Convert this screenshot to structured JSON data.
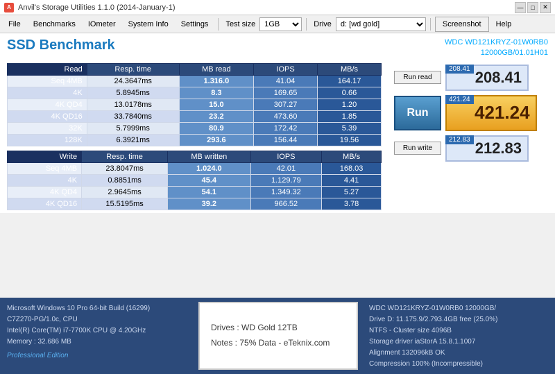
{
  "titleBar": {
    "title": "Anvil's Storage Utilities 1.1.0 (2014-January-1)",
    "icon": "A",
    "controls": [
      "—",
      "□",
      "✕"
    ]
  },
  "menuBar": {
    "items": [
      "File",
      "Benchmarks",
      "IOmeter",
      "System Info",
      "Settings"
    ],
    "testSizeLabel": "Test size",
    "testSizeValue": "1GB",
    "driveLabel": "Drive",
    "driveValue": "d: [wd gold]",
    "screenshotLabel": "Screenshot",
    "helpLabel": "Help"
  },
  "header": {
    "title": "SSD Benchmark",
    "driveModel": "WDC WD121KRYZ-01W0RB0",
    "driveSize": "12000GB/01.01H01"
  },
  "readTable": {
    "headers": [
      "Read",
      "Resp. time",
      "MB read",
      "IOPS",
      "MB/s"
    ],
    "rows": [
      {
        "label": "Seq 4MB",
        "resp": "24.3647ms",
        "mb": "1.316.0",
        "iops": "41.04",
        "mbs": "164.17"
      },
      {
        "label": "4K",
        "resp": "5.8945ms",
        "mb": "8.3",
        "iops": "169.65",
        "mbs": "0.66"
      },
      {
        "label": "4K QD4",
        "resp": "13.0178ms",
        "mb": "15.0",
        "iops": "307.27",
        "mbs": "1.20"
      },
      {
        "label": "4K QD16",
        "resp": "33.7840ms",
        "mb": "23.2",
        "iops": "473.60",
        "mbs": "1.85"
      },
      {
        "label": "32K",
        "resp": "5.7999ms",
        "mb": "80.9",
        "iops": "172.42",
        "mbs": "5.39"
      },
      {
        "label": "128K",
        "resp": "6.3921ms",
        "mb": "293.6",
        "iops": "156.44",
        "mbs": "19.56"
      }
    ]
  },
  "writeTable": {
    "headers": [
      "Write",
      "Resp. time",
      "MB written",
      "IOPS",
      "MB/s"
    ],
    "rows": [
      {
        "label": "Seq 4MB",
        "resp": "23.8047ms",
        "mb": "1.024.0",
        "iops": "42.01",
        "mbs": "168.03"
      },
      {
        "label": "4K",
        "resp": "0.8851ms",
        "mb": "45.4",
        "iops": "1.129.79",
        "mbs": "4.41"
      },
      {
        "label": "4K QD4",
        "resp": "2.9645ms",
        "mb": "54.1",
        "iops": "1.349.32",
        "mbs": "5.27"
      },
      {
        "label": "4K QD16",
        "resp": "15.5195ms",
        "mb": "39.2",
        "iops": "966.52",
        "mbs": "3.78"
      }
    ]
  },
  "scores": {
    "readScore": {
      "badge": "208.41",
      "main": "208.41"
    },
    "totalScore": {
      "badge": "421.24",
      "main": "421.24"
    },
    "writeScore": {
      "badge": "212.83",
      "main": "212.83"
    }
  },
  "buttons": {
    "runRead": "Run read",
    "run": "Run",
    "runWrite": "Run write"
  },
  "bottomLeft": {
    "line1": "Microsoft Windows 10 Pro 64-bit Build (16299)",
    "line2": "C7Z270-PG/1.0c, CPU",
    "line3": "Intel(R) Core(TM) i7-7700K CPU @ 4.20GHz",
    "line4": "Memory : 32.686 MB",
    "proEdition": "Professional Edition"
  },
  "bottomCenter": {
    "line1": "Drives : WD Gold 12TB",
    "line2": "Notes : 75% Data - eTeknix.com"
  },
  "bottomRight": {
    "line1": "WDC WD121KRYZ-01W0RB0 12000GB/",
    "line2": "Drive D: 11.175.9/2.793.4GB free (25.0%)",
    "line3": "NTFS - Cluster size 4096B",
    "line4": "Storage driver  iaStorA 15.8.1.1007",
    "line5": "Alignment 132096kB OK",
    "line6": "Compression 100% (Incompressible)"
  }
}
